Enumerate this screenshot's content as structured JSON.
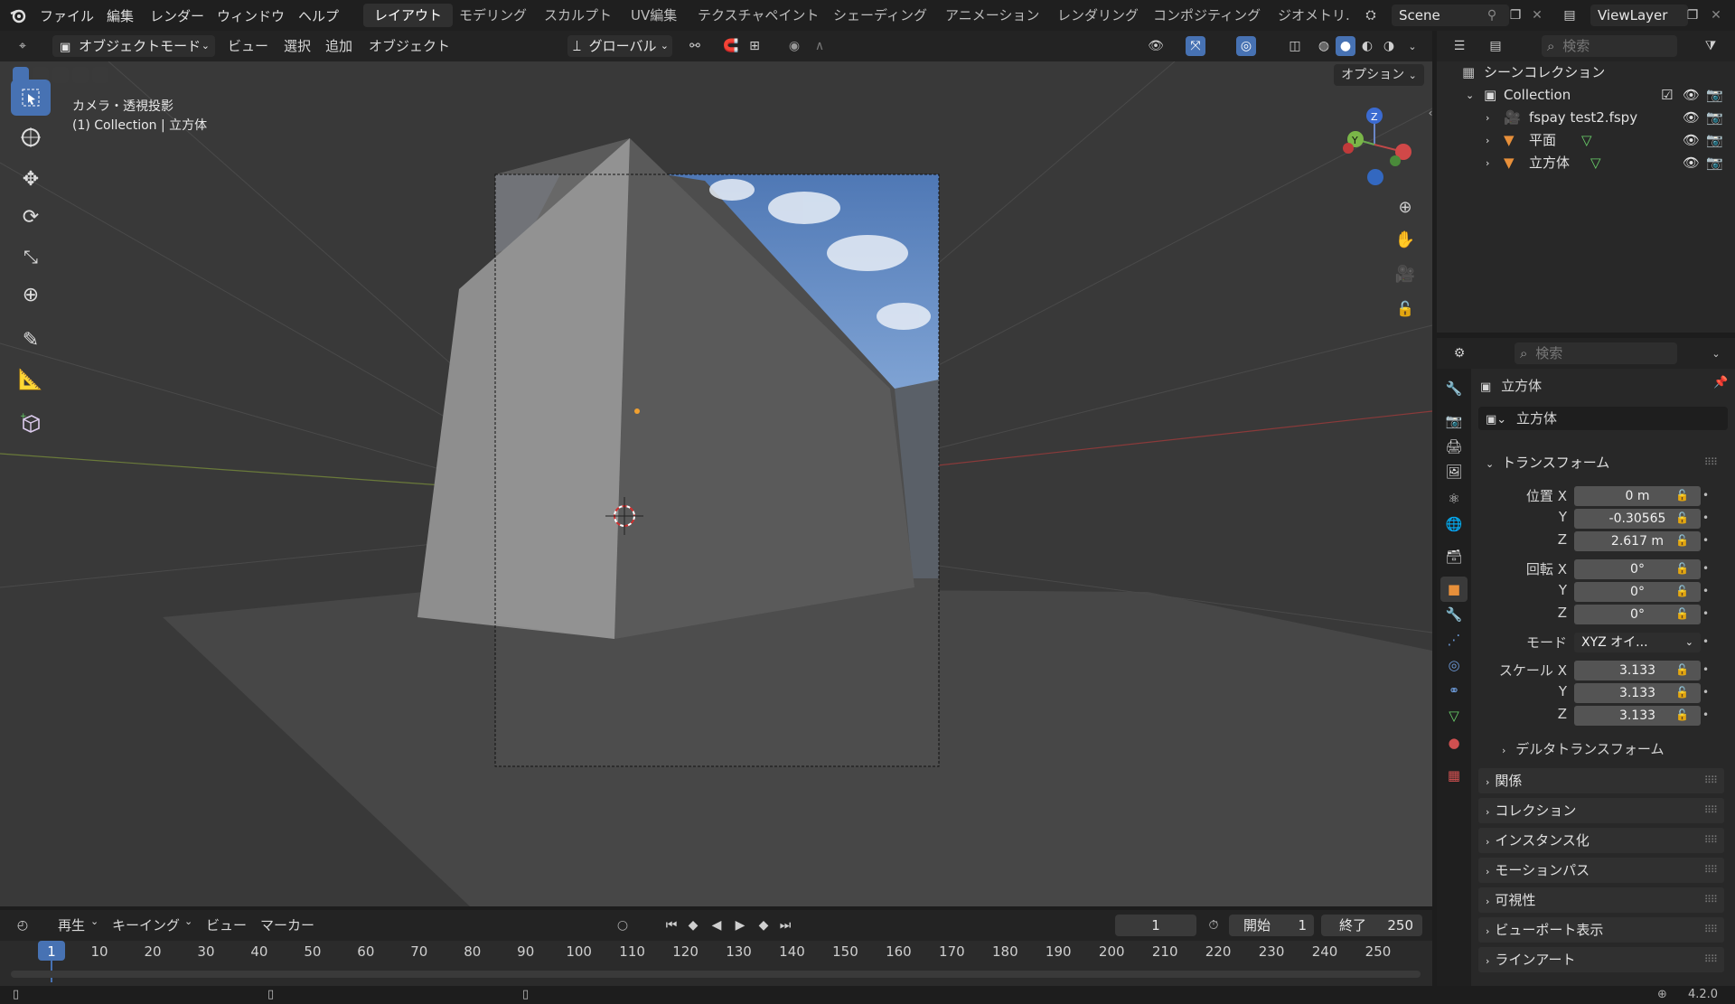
{
  "app": {
    "name": "Blender",
    "version": "4.2.0"
  },
  "top_menu": [
    "ファイル",
    "編集",
    "レンダー",
    "ウィンドウ",
    "ヘルプ"
  ],
  "workspaces": [
    {
      "label": "レイアウト",
      "active": true
    },
    {
      "label": "モデリング",
      "active": false
    },
    {
      "label": "スカルプト",
      "active": false
    },
    {
      "label": "UV編集",
      "active": false
    },
    {
      "label": "テクスチャペイント",
      "active": false
    },
    {
      "label": "シェーディング",
      "active": false
    },
    {
      "label": "アニメーション",
      "active": false
    },
    {
      "label": "レンダリング",
      "active": false
    },
    {
      "label": "コンポジティング",
      "active": false
    },
    {
      "label": "ジオメトリ.",
      "active": false
    }
  ],
  "scene": {
    "name": "Scene",
    "view_layer": "ViewLayer"
  },
  "viewport_header": {
    "mode": "オブジェクトモード",
    "menus": [
      "ビュー",
      "選択",
      "追加",
      "オブジェクト"
    ],
    "orientation": "グローバル",
    "options_label": "オプション"
  },
  "viewport": {
    "info_line1": "カメラ・透視投影",
    "info_line2": "(1) Collection | 立方体",
    "gizmo": {
      "z": "Z",
      "y": "Y",
      "x": "X"
    }
  },
  "outliner": {
    "search_placeholder": "検索",
    "root": "シーンコレクション",
    "items": [
      {
        "label": "Collection",
        "level": 1
      },
      {
        "label": "fspay test2.fspy",
        "level": 2
      },
      {
        "label": "平面",
        "level": 2
      },
      {
        "label": "立方体",
        "level": 2
      }
    ]
  },
  "properties": {
    "search_placeholder": "検索",
    "object_name": "立方体",
    "data_name": "立方体",
    "transform_title": "トランスフォーム",
    "location": {
      "label": "位置",
      "x": "0 m",
      "y": "-0.30565",
      "z": "2.617 m"
    },
    "rotation": {
      "label": "回転",
      "x": "0°",
      "y": "0°",
      "z": "0°"
    },
    "mode": {
      "label": "モード",
      "value": "XYZ オイ..."
    },
    "scale": {
      "label": "スケール",
      "x": "3.133",
      "y": "3.133",
      "z": "3.133"
    },
    "axis": {
      "x": "X",
      "y": "Y",
      "z": "Z"
    },
    "delta_transform": "デルタトランスフォーム",
    "sections": [
      "関係",
      "コレクション",
      "インスタンス化",
      "モーションパス",
      "可視性",
      "ビューポート表示",
      "ラインアート"
    ]
  },
  "timeline": {
    "menus": [
      "再生",
      "キーイング",
      "ビュー",
      "マーカー"
    ],
    "current_frame": "1",
    "start_label": "開始",
    "start": "1",
    "end_label": "終了",
    "end": "250",
    "ticks": [
      "1",
      "10",
      "20",
      "30",
      "40",
      "50",
      "60",
      "70",
      "80",
      "90",
      "100",
      "110",
      "120",
      "130",
      "140",
      "150",
      "160",
      "170",
      "180",
      "190",
      "200",
      "210",
      "220",
      "230",
      "240",
      "250"
    ]
  },
  "status": {
    "version": "4.2.0"
  }
}
